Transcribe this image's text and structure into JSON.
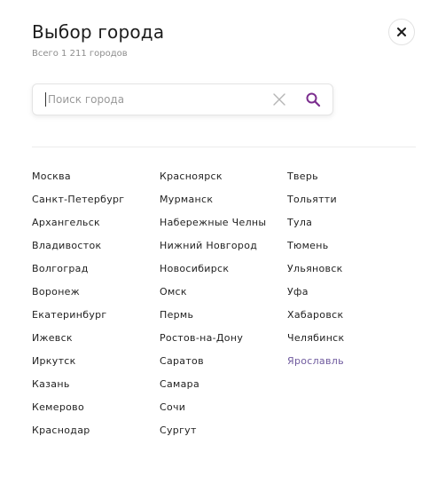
{
  "dialog": {
    "title": "Выбор города",
    "subtitle": "Всего 1 211 городов",
    "close_icon": "close-icon"
  },
  "search": {
    "placeholder": "Поиск города",
    "value": "",
    "clear_icon": "clear-icon",
    "search_icon": "search-icon",
    "accent_color": "#7b2d8e"
  },
  "cities": {
    "column1": [
      "Москва",
      "Санкт-Петербург",
      "Архангельск",
      "Владивосток",
      "Волгоград",
      "Воронеж",
      "Екатеринбург",
      "Ижевск",
      "Иркутск",
      "Казань",
      "Кемерово",
      "Краснодар"
    ],
    "column2": [
      "Красноярск",
      "Мурманск",
      "Набережные Челны",
      "Нижний Новгород",
      "Новосибирск",
      "Омск",
      "Пермь",
      "Ростов-на-Дону",
      "Саратов",
      "Самара",
      "Сочи",
      "Сургут"
    ],
    "column3": [
      "Тверь",
      "Тольятти",
      "Тула",
      "Тюмень",
      "Ульяновск",
      "Уфа",
      "Хабаровск",
      "Челябинск",
      "Ярославль"
    ],
    "selected": "Ярославль",
    "selected_color": "#6f5a9e"
  }
}
